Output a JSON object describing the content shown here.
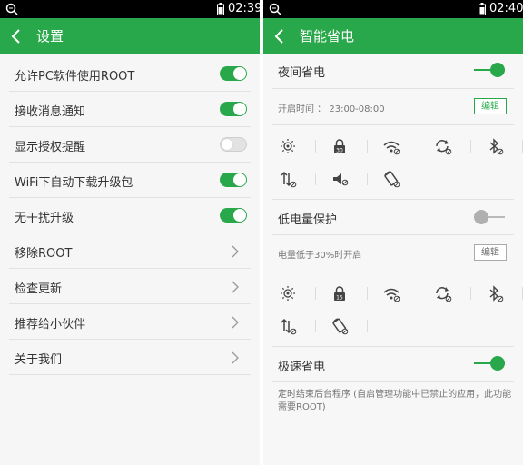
{
  "left": {
    "status": {
      "time": "02:39"
    },
    "title": "设置",
    "settings": [
      {
        "label": "允许PC软件使用ROOT",
        "control": "toggle",
        "on": true
      },
      {
        "label": "接收消息通知",
        "control": "toggle",
        "on": true
      },
      {
        "label": "显示授权提醒",
        "control": "toggle",
        "on": false
      },
      {
        "label": "WiFi下自动下载升级包",
        "control": "toggle",
        "on": true
      },
      {
        "label": "无干扰升级",
        "control": "toggle",
        "on": true
      },
      {
        "label": "移除ROOT",
        "control": "arrow"
      },
      {
        "label": "检查更新",
        "control": "arrow"
      },
      {
        "label": "推荐给小伙伴",
        "control": "arrow"
      },
      {
        "label": "关于我们",
        "control": "arrow"
      }
    ]
  },
  "right": {
    "status": {
      "time": "02:40"
    },
    "title": "智能省电",
    "night": {
      "title": "夜间省电",
      "on": true,
      "time_text": "开启时间 ： 23:00-08:00",
      "edit_label": "编辑",
      "icons_row1": [
        "brightness-icon",
        "screen-lock-icon",
        "wifi-off-icon",
        "sync-off-icon",
        "bluetooth-off-icon"
      ],
      "icons_row2": [
        "mobile-data-off-icon",
        "sound-off-icon",
        "auto-rotate-off-icon"
      ],
      "lock_number": "30"
    },
    "low": {
      "title": "低电量保护",
      "on": false,
      "trigger_text": "电量低于30%时开启",
      "edit_label": "编辑",
      "icons_row1": [
        "brightness-icon",
        "screen-lock-icon",
        "wifi-off-icon",
        "sync-off-icon",
        "bluetooth-off-icon"
      ],
      "icons_row2": [
        "mobile-data-off-icon",
        "auto-rotate-off-icon"
      ],
      "lock_number": "15"
    },
    "fast": {
      "title": "极速省电",
      "on": true,
      "description": "定时结束后台程序 (自启管理功能中已禁止的应用，此功能需要ROOT)"
    }
  },
  "colors": {
    "accent": "#28a84a",
    "statusbar": "#000000"
  }
}
